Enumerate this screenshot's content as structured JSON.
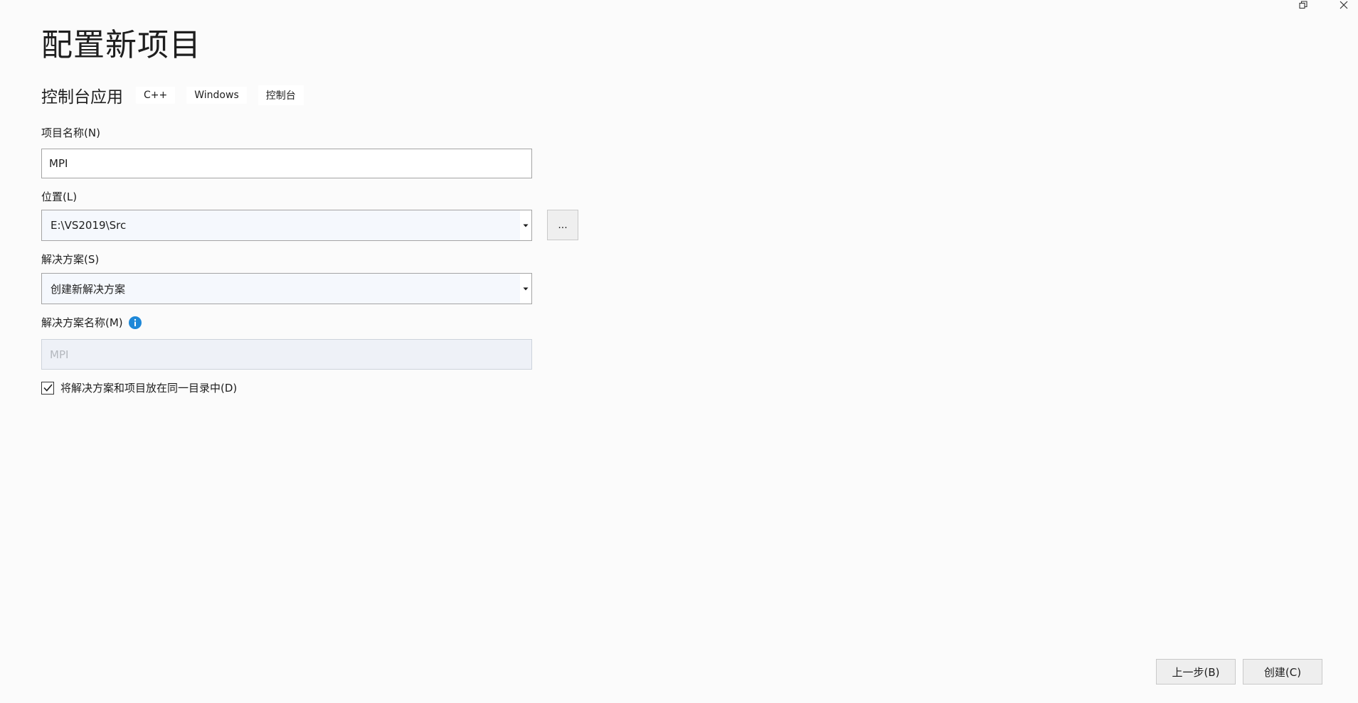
{
  "window": {
    "restore_icon": "restore-icon",
    "close_icon": "close-icon"
  },
  "title": "配置新项目",
  "template": {
    "name": "控制台应用",
    "tags": [
      "C++",
      "Windows",
      "控制台"
    ]
  },
  "project_name": {
    "label": "项目名称(N)",
    "value": "MPI"
  },
  "location": {
    "label": "位置(L)",
    "value": "E:\\VS2019\\Src",
    "browse_label": "..."
  },
  "solution": {
    "label": "解决方案(S)",
    "value": "创建新解决方案"
  },
  "solution_name": {
    "label": "解决方案名称(M)",
    "value": "MPI",
    "info_icon": "info-icon"
  },
  "same_directory": {
    "label": "将解决方案和项目放在同一目录中(D)",
    "checked": true
  },
  "footer": {
    "back_label": "上一步(B)",
    "create_label": "创建(C)"
  },
  "colors": {
    "background": "#fbfbfb",
    "info_icon": "#1e88d8",
    "input_border": "#a4a4a4",
    "disabled_bg": "#eef1f7"
  }
}
